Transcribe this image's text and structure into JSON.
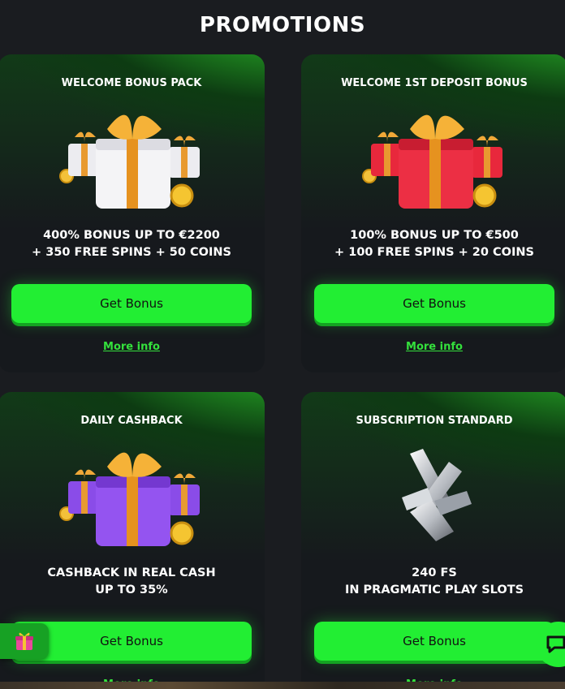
{
  "page": {
    "title": "PROMOTIONS"
  },
  "cards": [
    {
      "title": "WELCOME BONUS PACK",
      "desc_line1": "400% BONUS UP TO €2200",
      "desc_line2": "+ 350 FREE SPINS + 50 COINS",
      "button": "Get Bonus",
      "link": "More info",
      "art": "gift-white-icon",
      "gift_color": "#f2f2f4"
    },
    {
      "title": "WELCOME 1ST DEPOSIT BONUS",
      "desc_line1": "100% BONUS UP TO €500",
      "desc_line2": "+ 100 FREE SPINS + 20 COINS",
      "button": "Get Bonus",
      "link": "More info",
      "art": "gift-red-icon",
      "gift_color": "#e8283c"
    },
    {
      "title": "DAILY CASHBACK",
      "desc_line1": "CASHBACK IN REAL CASH",
      "desc_line2": "UP TO 35%",
      "button": "Get Bonus",
      "link": "More info",
      "art": "gift-purple-icon",
      "gift_color": "#8a4ce8"
    },
    {
      "title": "SUBSCRIPTION STANDARD",
      "desc_line1": "240 FS",
      "desc_line2": "IN PRAGMATIC PLAY SLOTS",
      "button": "Get Bonus",
      "link": "More info",
      "art": "silver-x-logo-icon"
    }
  ],
  "widgets": {
    "gift": "gift-widget-icon",
    "chat": "chat-icon"
  },
  "colors": {
    "accent": "#22ee33",
    "background": "#1a1c20",
    "link": "#34e03c"
  }
}
